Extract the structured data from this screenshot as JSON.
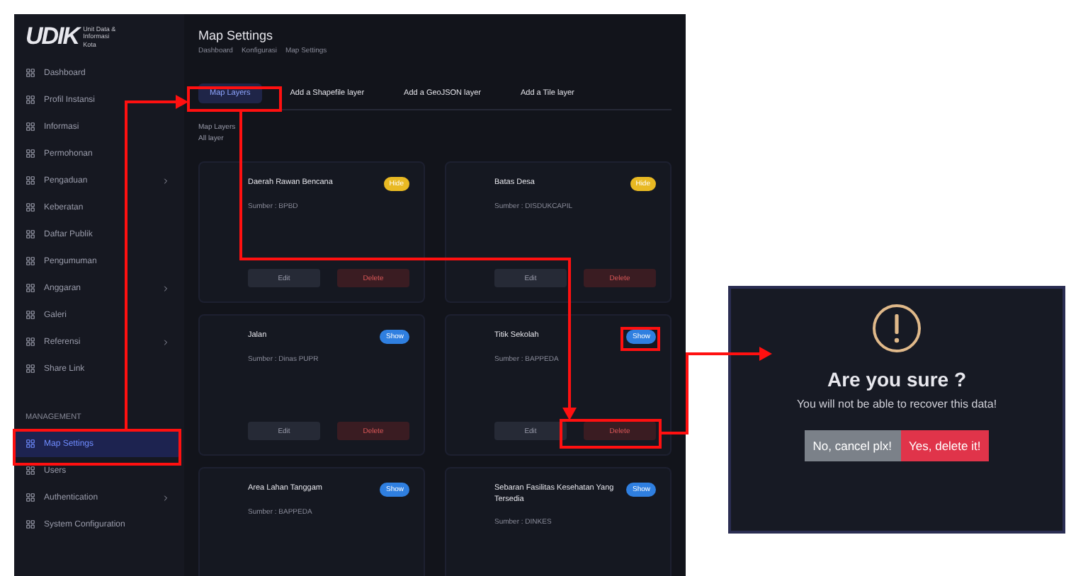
{
  "logo": {
    "text": "UDIK",
    "subtitle": "Unit Data & Informasi Kota"
  },
  "sidebar": {
    "items": [
      {
        "label": "Dashboard",
        "selected": false,
        "expandable": false
      },
      {
        "label": "Profil Instansi",
        "selected": false,
        "expandable": false
      },
      {
        "label": "Informasi",
        "selected": false,
        "expandable": false
      },
      {
        "label": "Permohonan",
        "selected": false,
        "expandable": false
      },
      {
        "label": "Pengaduan",
        "selected": false,
        "expandable": true
      },
      {
        "label": "Keberatan",
        "selected": false,
        "expandable": false
      },
      {
        "label": "Daftar Publik",
        "selected": false,
        "expandable": false
      },
      {
        "label": "Pengumuman",
        "selected": false,
        "expandable": false
      },
      {
        "label": "Anggaran",
        "selected": false,
        "expandable": true
      },
      {
        "label": "Galeri",
        "selected": false,
        "expandable": false
      },
      {
        "label": "Referensi",
        "selected": false,
        "expandable": true
      },
      {
        "label": "Share Link",
        "selected": false,
        "expandable": false
      }
    ],
    "section": "MANAGEMENT",
    "management_items": [
      {
        "label": "Map Settings",
        "selected": true,
        "expandable": false
      },
      {
        "label": "Users",
        "selected": false,
        "expandable": false
      },
      {
        "label": "Authentication",
        "selected": false,
        "expandable": true
      },
      {
        "label": "System Configuration",
        "selected": false,
        "expandable": false
      }
    ]
  },
  "page": {
    "title": "Map Settings",
    "breadcrumb": [
      "Dashboard",
      "Konfigurasi",
      "Map Settings"
    ]
  },
  "tabs": [
    {
      "label": "Map Layers",
      "selected": true
    },
    {
      "label": "Add a Shapefile layer",
      "selected": false
    },
    {
      "label": "Add a GeoJSON layer",
      "selected": false
    },
    {
      "label": "Add a Tile layer",
      "selected": false
    }
  ],
  "list": {
    "heading": "Map Layers",
    "count": "All layer"
  },
  "cards": [
    {
      "title": "Daerah Rawan Bencana",
      "source": "Sumber : BPBD",
      "badge": "Hide",
      "color": "#e8b923",
      "buttons": [
        "Edit",
        "Delete"
      ]
    },
    {
      "title": "Batas Desa",
      "source": "Sumber : DISDUKCAPIL",
      "badge": "Hide",
      "color": "#e8b923",
      "buttons": [
        "Edit",
        "Delete"
      ]
    },
    {
      "title": "Jalan",
      "source": "Sumber : Dinas PUPR",
      "badge": "Show",
      "color": "#2f7fe0",
      "buttons": [
        "Edit",
        "Delete"
      ]
    },
    {
      "title": "Titik Sekolah",
      "source": "Sumber : BAPPEDA",
      "badge": "Show",
      "color": "#2f7fe0",
      "buttons": [
        "Edit",
        "Delete"
      ]
    },
    {
      "title": "Area Lahan Tanggam",
      "source": "Sumber : BAPPEDA",
      "badge": "Show",
      "color": "#2f7fe0"
    },
    {
      "title": "Sebaran Fasilitas Kesehatan Yang Tersedia",
      "source": "Sumber : DINKES",
      "badge": "Show",
      "color": "#2f7fe0"
    }
  ],
  "dialog": {
    "title": "Are you sure ?",
    "message": "You will not be able to recover this data!",
    "buttons": [
      {
        "label": "No, cancel plx!",
        "kind": "cancel"
      },
      {
        "label": "Yes, delete it!",
        "kind": "confirm"
      }
    ]
  }
}
